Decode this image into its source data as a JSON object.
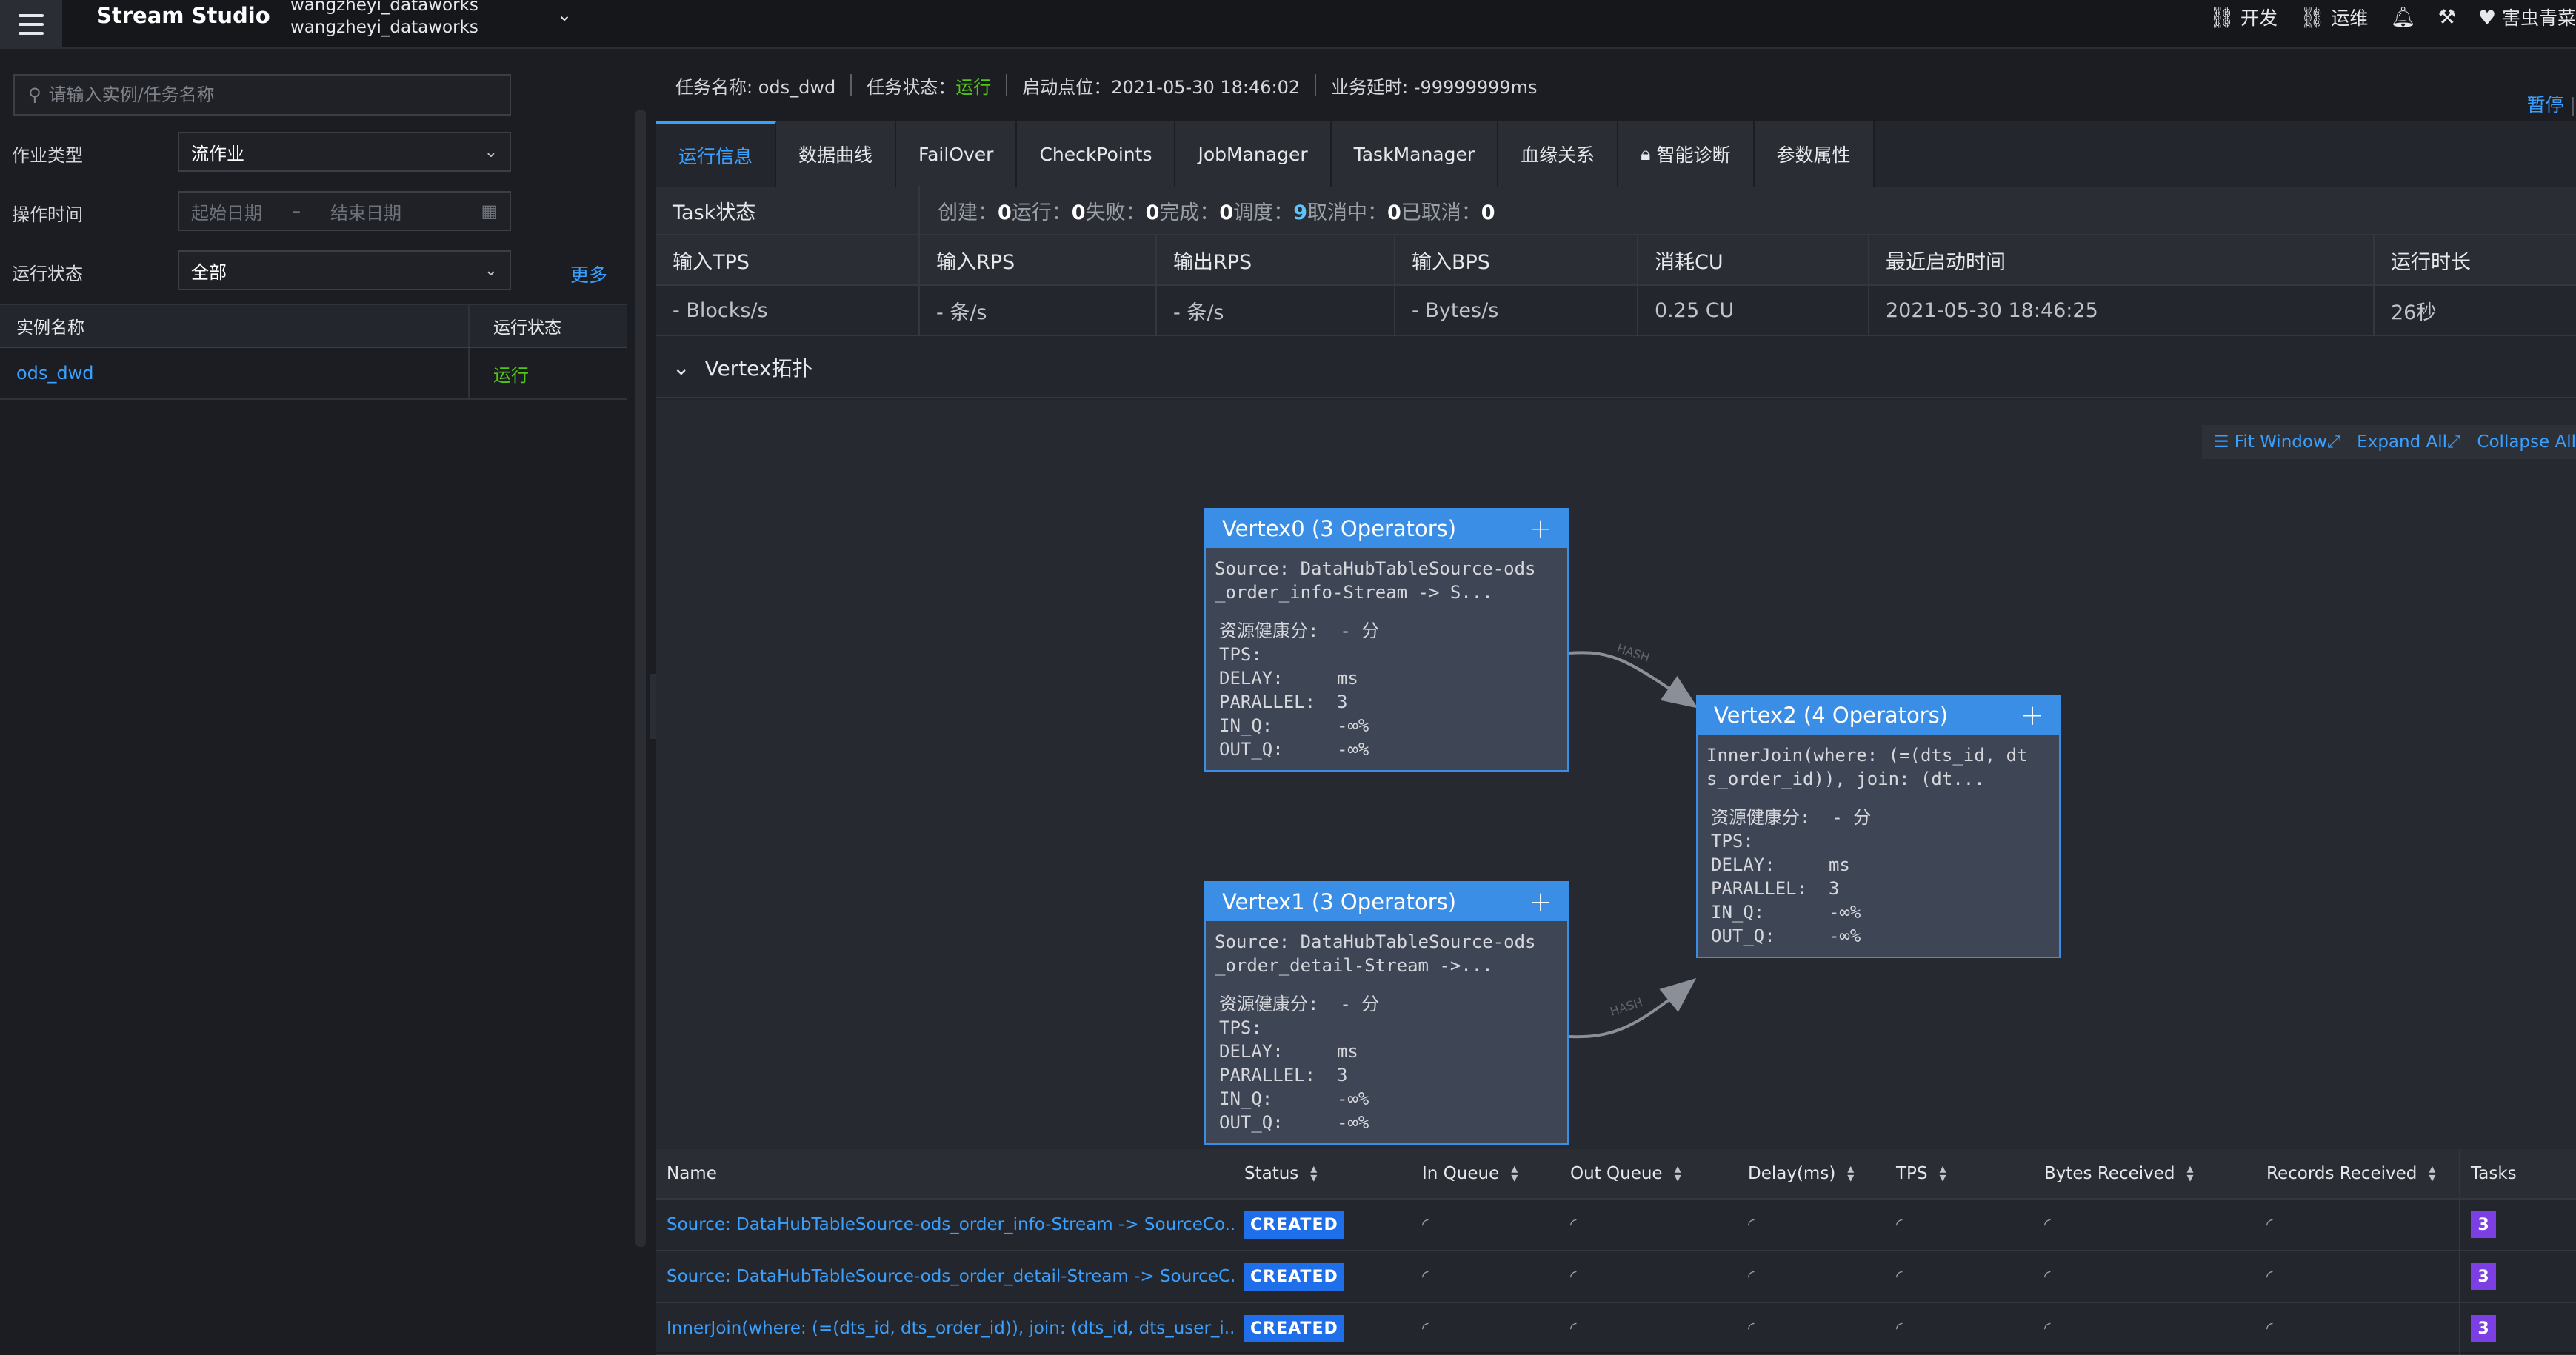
{
  "topbar": {
    "brand": "Stream Studio",
    "account_line1": "wangzheyi_dataworks",
    "account_line2": "wangzheyi_dataworks",
    "dev_label": "开发",
    "ops_label": "运维",
    "user_label": "害虫青菜"
  },
  "left": {
    "search_placeholder": "请输入实例/任务名称",
    "job_type_label": "作业类型",
    "job_type_value": "流作业",
    "op_time_label": "操作时间",
    "start_date_placeholder": "起始日期",
    "date_sep": "–",
    "end_date_placeholder": "结束日期",
    "run_state_label": "运行状态",
    "run_state_value": "全部",
    "more_label": "更多",
    "table": {
      "headers": [
        "实例名称",
        "运行状态"
      ],
      "rows": [
        {
          "name": "ods_dwd",
          "state": "运行"
        }
      ]
    }
  },
  "task": {
    "name_label": "任务名称: ods_dwd",
    "status_label": "任务状态：",
    "status_value": "运行",
    "start_point": "启动点位：2021-05-30 18:46:02",
    "biz_delay": "业务延时: -99999999ms",
    "pause_label": "暂停"
  },
  "tabs": [
    "运行信息",
    "数据曲线",
    "FailOver",
    "CheckPoints",
    "JobManager",
    "TaskManager",
    "血缘关系",
    "智能诊断",
    "参数属性"
  ],
  "task_state": {
    "label": "Task状态",
    "created_label": "创建：",
    "created": "0",
    "running_label": "运行：",
    "running": "0",
    "failed_label": "失败：",
    "failed": "0",
    "finished_label": "完成：",
    "finished": "0",
    "scheduled_label": "调度：",
    "scheduled": "9",
    "cancelling_label": "取消中：",
    "cancelling": "0",
    "cancelled_label": "已取消：",
    "cancelled": "0"
  },
  "metrics": {
    "headers": [
      "输入TPS",
      "输入RPS",
      "输出RPS",
      "输入BPS",
      "消耗CU",
      "最近启动时间",
      "运行时长"
    ],
    "values": [
      "- Blocks/s",
      "- 条/s",
      "- 条/s",
      "- Bytes/s",
      "0.25 CU",
      "2021-05-30 18:46:25",
      "26秒"
    ]
  },
  "vertex_section_title": "Vertex拓扑",
  "graph_tools": {
    "fit": "Fit Window",
    "expand": "Expand All",
    "collapse": "Collapse All"
  },
  "edge_label": "HASH",
  "vertices": [
    {
      "title": "Vertex0 (3 Operators)",
      "desc_line1": "Source: DataHubTableSource-ods",
      "desc_line2": "_order_info-Stream -> S...",
      "health": "资源健康分:  - 分",
      "tps": "TPS:",
      "delay": "DELAY:     ms",
      "parallel": "PARALLEL:  3",
      "in_q": "IN_Q:      -∞%",
      "out_q": "OUT_Q:     -∞%"
    },
    {
      "title": "Vertex1 (3 Operators)",
      "desc_line1": "Source: DataHubTableSource-ods",
      "desc_line2": "_order_detail-Stream ->...",
      "health": "资源健康分:  - 分",
      "tps": "TPS:",
      "delay": "DELAY:     ms",
      "parallel": "PARALLEL:  3",
      "in_q": "IN_Q:      -∞%",
      "out_q": "OUT_Q:     -∞%"
    },
    {
      "title": "Vertex2 (4 Operators)",
      "desc_line1": "InnerJoin(where: (=(dts_id, dt",
      "desc_line2": "s_order_id)), join: (dt...",
      "health": "资源健康分:  - 分",
      "tps": "TPS:",
      "delay": "DELAY:     ms",
      "parallel": "PARALLEL:  3",
      "in_q": "IN_Q:      -∞%",
      "out_q": "OUT_Q:     -∞%"
    }
  ],
  "operators": {
    "headers": [
      "Name",
      "Status",
      "In Queue",
      "Out Queue",
      "Delay(ms)",
      "TPS",
      "Bytes Received",
      "Records Received",
      "Tasks"
    ],
    "rows": [
      {
        "name": "Source: DataHubTableSource-ods_order_info-Stream -> SourceCo...",
        "status": "CREATED",
        "tasks": "3"
      },
      {
        "name": "Source: DataHubTableSource-ods_order_detail-Stream -> SourceC...",
        "status": "CREATED",
        "tasks": "3"
      },
      {
        "name": "InnerJoin(where: (=(dts_id, dts_order_id)), join: (dts_id, dts_user_i...",
        "status": "CREATED",
        "tasks": "3"
      }
    ]
  },
  "colors": {
    "accent": "#3aa0ff",
    "success": "#52c41a",
    "node": "#3a8ee6",
    "task_badge": "#7b3fe4",
    "created_badge": "#1f6feb"
  }
}
